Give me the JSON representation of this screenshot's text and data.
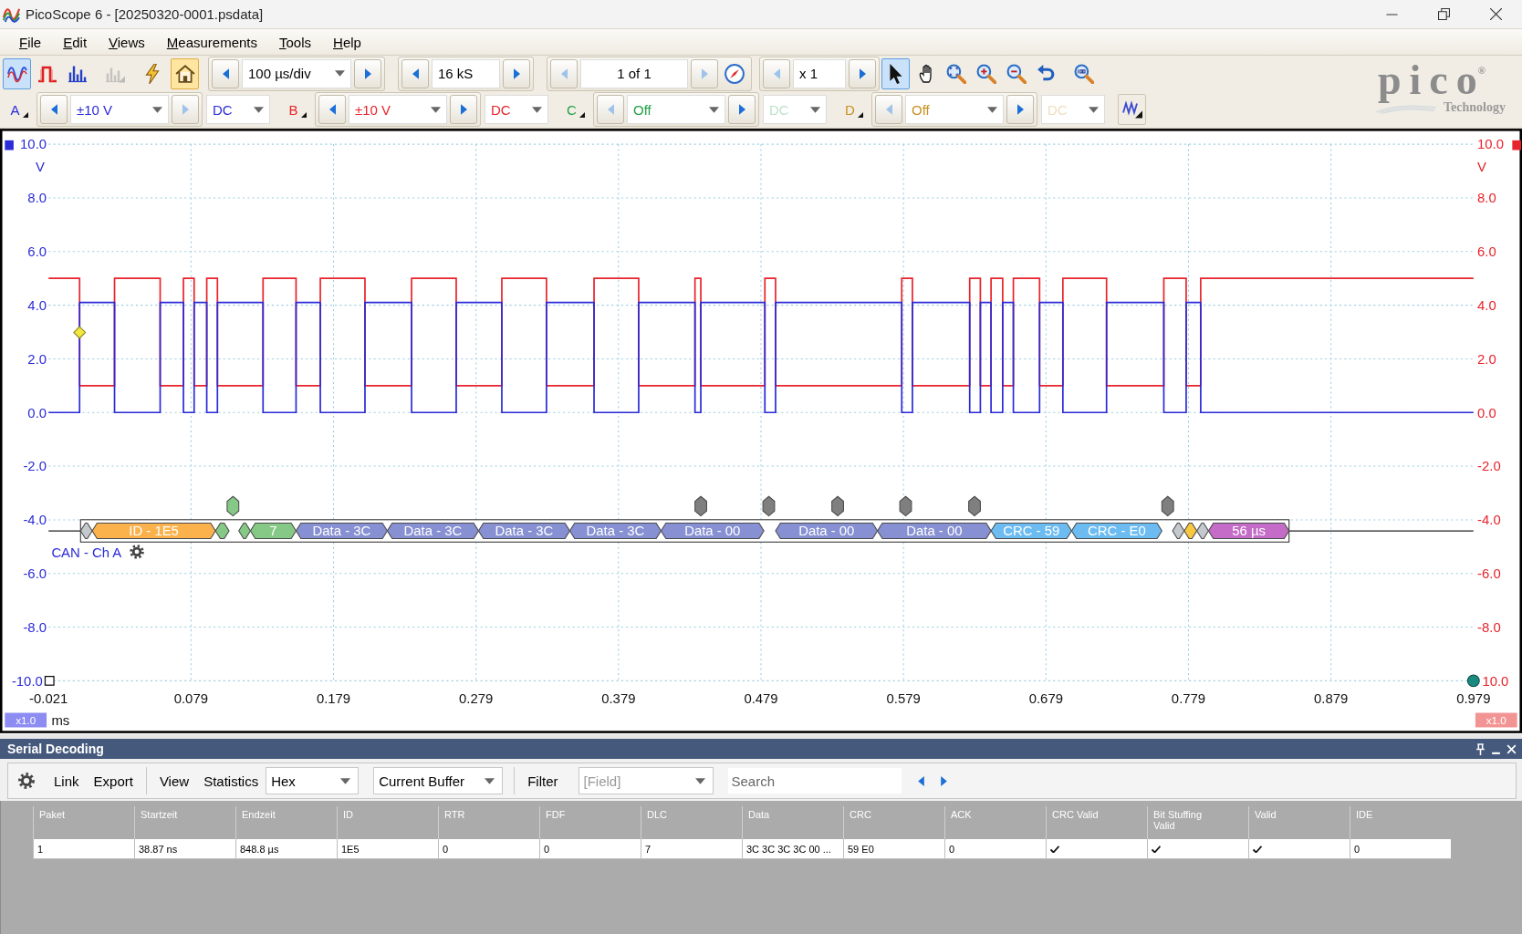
{
  "window": {
    "title": "PicoScope 6 - [20250320-0001.psdata]"
  },
  "menu": [
    "File",
    "Edit",
    "Views",
    "Measurements",
    "Tools",
    "Help"
  ],
  "toolbar": {
    "modes": [
      {
        "kind": "scope",
        "selected": true,
        "disabled": false
      },
      {
        "kind": "persistence",
        "selected": false,
        "disabled": false
      },
      {
        "kind": "spectrum",
        "selected": false,
        "disabled": false
      },
      {
        "kind": "xy",
        "selected": false,
        "disabled": true
      }
    ],
    "actions": [
      {
        "kind": "trigger",
        "selected": false
      },
      {
        "kind": "auto-setup",
        "selected": true
      }
    ],
    "spinners": [
      {
        "kind": "timebase",
        "value": "100 µs/div",
        "prev_enabled": true,
        "next_enabled": true
      },
      {
        "kind": "samples",
        "value": "16 kS",
        "prev_enabled": true,
        "next_enabled": true
      },
      {
        "kind": "buffer",
        "value": "1 of 1",
        "prev_enabled": false,
        "next_enabled": false
      },
      {
        "kind": "zoom",
        "value": "x 1",
        "prev_enabled": false,
        "next_enabled": true
      }
    ],
    "tools": [
      {
        "kind": "pointer",
        "selected": true
      },
      {
        "kind": "hand",
        "selected": false
      },
      {
        "kind": "zoom-area",
        "selected": false
      },
      {
        "kind": "zoom-in",
        "selected": false
      },
      {
        "kind": "zoom-out",
        "selected": false
      },
      {
        "kind": "undo",
        "selected": false
      },
      {
        "kind": "zoom-fit",
        "selected": false
      }
    ]
  },
  "logo": {
    "wordmark": "pico$^{®}$",
    "tagline": "Technology"
  },
  "channels": [
    {
      "label": "A",
      "color": "#2b2bd8",
      "enabled": true,
      "range": "±10 V",
      "coupling": "DC",
      "prev_enabled": true,
      "next_enabled": false
    },
    {
      "label": "B",
      "color": "#e8232b",
      "enabled": true,
      "range": "±10 V",
      "coupling": "DC",
      "prev_enabled": true,
      "next_enabled": true
    },
    {
      "label": "C",
      "color": "#22a046",
      "enabled": false,
      "range": "Off",
      "coupling": "DC",
      "prev_enabled": false,
      "next_enabled": true
    },
    {
      "label": "D",
      "color": "#c89020",
      "enabled": false,
      "range": "Off",
      "coupling": "DC",
      "prev_enabled": false,
      "next_enabled": true
    }
  ],
  "scope": {
    "left_axis": {
      "unit": "V",
      "ticks": [
        "10.0",
        "8.0",
        "6.0",
        "4.0",
        "2.0",
        "0.0",
        "-2.0",
        "-4.0",
        "-6.0",
        "-8.0",
        "-10.0"
      ],
      "scale": "x1.0"
    },
    "right_axis": {
      "unit": "V",
      "ticks": [
        "10.0",
        "8.0",
        "6.0",
        "4.0",
        "2.0",
        "0.0",
        "-2.0",
        "-4.0",
        "-6.0",
        "-8.0",
        "10.0"
      ],
      "scale": "x1.0"
    },
    "time_axis": {
      "unit": "ms",
      "ticks": [
        "-0.021",
        "0.079",
        "0.179",
        "0.279",
        "0.379",
        "0.479",
        "0.579",
        "0.679",
        "0.779",
        "0.879",
        "0.979"
      ]
    }
  },
  "decoder": {
    "label": "CAN - Ch A",
    "segments": [
      {
        "kind": "marker",
        "color": "#c4c9ce"
      },
      {
        "kind": "field",
        "text": "ID - 1E5",
        "color": "#fbb24c"
      },
      {
        "kind": "marker",
        "color": "#86c986"
      },
      {
        "kind": "marker",
        "color": "#86c986"
      },
      {
        "kind": "field",
        "text": "7",
        "color": "#86c986"
      },
      {
        "kind": "field",
        "text": "Data - 3C",
        "color": "#8690d2"
      },
      {
        "kind": "field",
        "text": "Data - 3C",
        "color": "#8690d2"
      },
      {
        "kind": "field",
        "text": "Data - 3C",
        "color": "#8690d2"
      },
      {
        "kind": "field",
        "text": "Data - 3C",
        "color": "#8690d2"
      },
      {
        "kind": "field",
        "text": "Data - 00",
        "color": "#8690d2"
      },
      {
        "kind": "field",
        "text": "Data - 00",
        "color": "#8690d2"
      },
      {
        "kind": "field",
        "text": "Data - 00",
        "color": "#8690d2"
      },
      {
        "kind": "field",
        "text": "CRC - 59",
        "color": "#6cbcf2"
      },
      {
        "kind": "field",
        "text": "CRC - E0",
        "color": "#6cbcf2"
      },
      {
        "kind": "marker",
        "color": "#c4c9ce"
      },
      {
        "kind": "marker",
        "color": "#f8c840"
      },
      {
        "kind": "marker",
        "color": "#c4c9ce"
      },
      {
        "kind": "field",
        "text": "56 µs",
        "color": "#c46cc8"
      }
    ],
    "stuff_bits": [
      {
        "color": "#86c986"
      },
      {
        "color": "#7f7f7f"
      },
      {
        "color": "#7f7f7f"
      },
      {
        "color": "#7f7f7f"
      },
      {
        "color": "#7f7f7f"
      },
      {
        "color": "#7f7f7f"
      },
      {
        "color": "#7f7f7f"
      }
    ]
  },
  "serial_decoding": {
    "title": "Serial Decoding",
    "toolbar": {
      "link": "Link",
      "export": "Export",
      "view": "View",
      "statistics": "Statistics",
      "format": "Hex",
      "source": "Current Buffer",
      "filter": "Filter",
      "field": {
        "placeholder": "[Field]"
      },
      "search": {
        "placeholder": "Search"
      }
    },
    "columns": [
      "Paket",
      "Startzeit",
      "Endzeit",
      "ID",
      "RTR",
      "FDF",
      "DLC",
      "Data",
      "CRC",
      "ACK",
      "CRC Valid",
      "Bit Stuffing Valid",
      "Valid",
      "IDE"
    ],
    "rows": [
      {
        "cells": [
          {
            "kind": "text",
            "value": "1"
          },
          {
            "kind": "text",
            "value": "38.87 ns"
          },
          {
            "kind": "text",
            "value": "848.8 µs"
          },
          {
            "kind": "text",
            "value": "1E5"
          },
          {
            "kind": "text",
            "value": "0"
          },
          {
            "kind": "text",
            "value": "0"
          },
          {
            "kind": "text",
            "value": "7"
          },
          {
            "kind": "text",
            "value": "3C 3C 3C 3C 00 ..."
          },
          {
            "kind": "text",
            "value": "59 E0"
          },
          {
            "kind": "text",
            "value": "0"
          },
          {
            "kind": "check",
            "checked": true
          },
          {
            "kind": "check",
            "checked": true
          },
          {
            "kind": "check",
            "checked": true
          },
          {
            "kind": "text",
            "value": "0"
          }
        ]
      }
    ]
  }
}
